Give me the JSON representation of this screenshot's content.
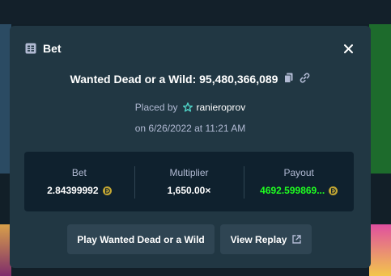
{
  "modal": {
    "title": "Bet",
    "close_icon": "close-icon",
    "bet_icon": "bet-slip-icon"
  },
  "game": {
    "label": "Wanted Dead or a Wild: 95,480,366,089",
    "copy_icon": "copy-icon",
    "link_icon": "link-icon"
  },
  "placed": {
    "prefix": "Placed by",
    "user_icon": "vip-star-icon",
    "username": "ranieroprov",
    "date": "on 6/26/2022 at 11:21 AM"
  },
  "stats": {
    "bet_label": "Bet",
    "bet_value": "2.84399992",
    "multiplier_label": "Multiplier",
    "multiplier_value": "1,650.00×",
    "payout_label": "Payout",
    "payout_value": "4692.599869...",
    "currency_icon": "dogecoin-icon"
  },
  "actions": {
    "play_label": "Play Wanted Dead or a Wild",
    "replay_label": "View Replay"
  },
  "colors": {
    "modal_bg": "#213743",
    "panel_bg": "#0f212e",
    "button_bg": "#2f4553",
    "muted_text": "#b1bad3",
    "payout_green": "#1fff20",
    "coin_gold": "#c2a633",
    "vip_teal": "#4fd1c5"
  }
}
